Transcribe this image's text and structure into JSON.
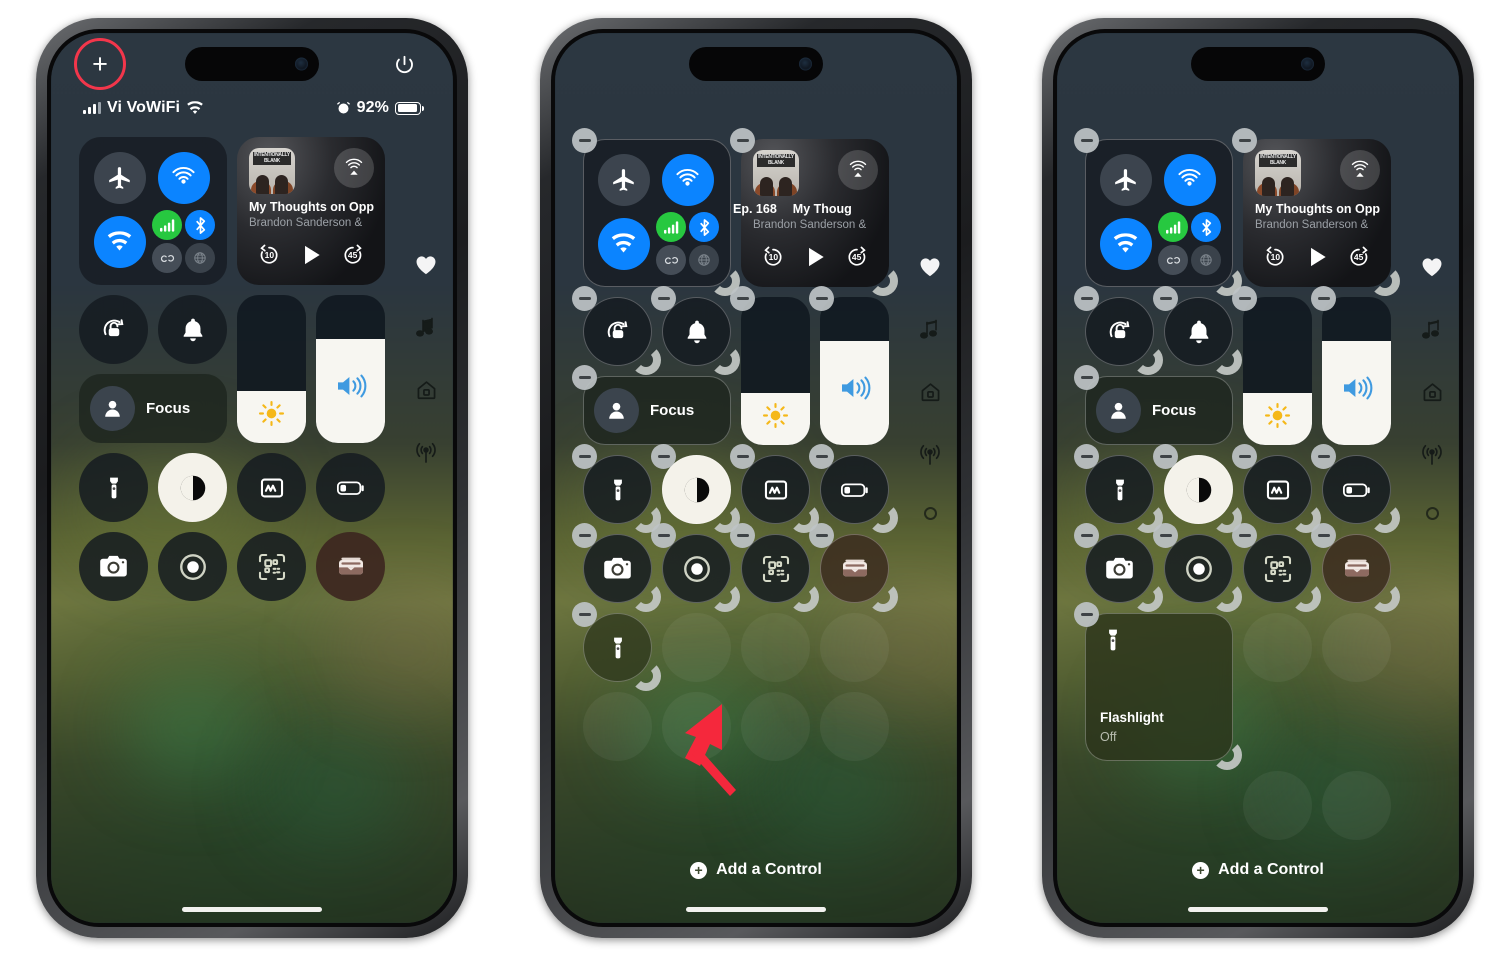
{
  "figure": {
    "panels": 3,
    "description": "iOS 18 Control Center customization: add control, resize flashlight, resulting large flashlight tile"
  },
  "status_bar": {
    "carrier": "Vi VoWiFi",
    "battery_percent": "92%",
    "signal_icon": "cellular-bars-icon",
    "wifi_icon": "wifi-icon",
    "alarm_icon": "alarm-clock-icon",
    "battery_icon": "battery-icon",
    "battery_fill_pct": 92
  },
  "top_chrome": {
    "add_button_glyph": "+",
    "add_button_name": "add-control-plus-button",
    "power_button_name": "power-icon",
    "highlight_color": "#f3364b"
  },
  "connectivity": {
    "airplane_label": "Airplane Mode",
    "airdrop_label": "AirDrop",
    "wifi_label": "Wi-Fi",
    "cellular_label": "Cellular Data",
    "bluetooth_label": "Bluetooth",
    "personal_hotspot_label": "Personal Hotspot",
    "vpn_label": "VPN",
    "colors": {
      "blue": "#0b84ff",
      "green": "#27c840",
      "grey": "#3c444e"
    }
  },
  "media": {
    "title_full": "My Thoughts on Opp",
    "title_episode": "Ep. 168",
    "title_episode_second": "My Thoug",
    "artist": "Brandon Sanderson &",
    "artwork_text": "INTENTIONALLY BLANK",
    "back_label": "10",
    "forward_label": "45",
    "play_icon": "play-icon",
    "airplay_icon": "airplay-icon"
  },
  "controls": {
    "rotation_lock": "rotation-lock-icon",
    "silent_mode": "bell-icon",
    "focus_label": "Focus",
    "focus_icon": "person-icon",
    "brightness_icon": "sun-icon",
    "brightness_pct": 35,
    "volume_icon": "speaker-icon",
    "volume_pct": 70,
    "flashlight": "flashlight-icon",
    "dark_mode": "dark-mode-icon",
    "text_size": "text-size-icon",
    "low_power": "low-power-battery-icon",
    "camera": "camera-icon",
    "screen_record": "screen-record-icon",
    "code_scanner": "qr-code-scanner-icon",
    "wallet": "wallet-icon"
  },
  "rail": {
    "items": [
      "heart-icon",
      "music-note-icon",
      "home-icon",
      "connectivity-icon"
    ],
    "page_dot": "page-indicator-dot"
  },
  "edit_mode": {
    "add_control_label": "Add a Control",
    "add_control_icon": "plus-circle-icon",
    "remove_badge_name": "remove-control-minus-badge",
    "resize_handle_name": "resize-handle"
  },
  "flashlight_expanded": {
    "title": "Flashlight",
    "state": "Off",
    "icon": "flashlight-icon"
  },
  "annotation": {
    "arrow_name": "callout-arrow",
    "arrow_color": "#f3364b",
    "circle_name": "callout-circle"
  }
}
